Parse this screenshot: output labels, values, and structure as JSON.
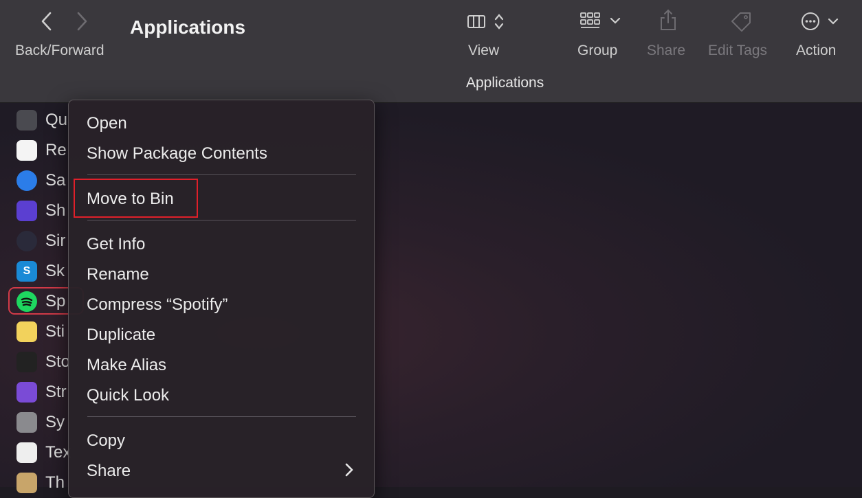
{
  "window": {
    "title": "Applications",
    "path_label": "Applications"
  },
  "toolbar": {
    "back_forward_label": "Back/Forward",
    "view_label": "View",
    "group_label": "Group",
    "share_label": "Share",
    "edit_tags_label": "Edit Tags",
    "action_label": "Action"
  },
  "apps": [
    {
      "name": "Qu",
      "icon": "quicktime-icon",
      "color": "#4a4a50"
    },
    {
      "name": "Re",
      "icon": "reminders-icon",
      "color": "#f4f4f4"
    },
    {
      "name": "Sa",
      "icon": "safari-icon",
      "color": "#2b7de9"
    },
    {
      "name": "Sh",
      "icon": "shortcuts-icon",
      "color": "#5b3fd1"
    },
    {
      "name": "Sir",
      "icon": "siri-icon",
      "color": "#2a2a3a"
    },
    {
      "name": "Sk",
      "icon": "skype-icon",
      "color": "#1a8ad6",
      "glyph": "S"
    },
    {
      "name": "Sp",
      "icon": "spotify-icon",
      "color": "#1ed760"
    },
    {
      "name": "Sti",
      "icon": "stickies-icon",
      "color": "#f2d25c"
    },
    {
      "name": "Sto",
      "icon": "stocks-icon",
      "color": "#222"
    },
    {
      "name": "Str",
      "icon": "strongbox-icon",
      "color": "#7a4bd6"
    },
    {
      "name": "Sy",
      "icon": "system-preferences-icon",
      "color": "#8a8a8e"
    },
    {
      "name": "Tex",
      "icon": "textedit-icon",
      "color": "#eeeeee"
    },
    {
      "name": "Th",
      "icon": "folder-icon",
      "color": "#c8a56a"
    }
  ],
  "context_menu": {
    "open": "Open",
    "show_package_contents": "Show Package Contents",
    "move_to_bin": "Move to Bin",
    "get_info": "Get Info",
    "rename": "Rename",
    "compress": "Compress “Spotify”",
    "duplicate": "Duplicate",
    "make_alias": "Make Alias",
    "quick_look": "Quick Look",
    "copy": "Copy",
    "share": "Share"
  },
  "colors": {
    "highlight_red": "#e0202a",
    "selection_outline": "#d23a48"
  }
}
